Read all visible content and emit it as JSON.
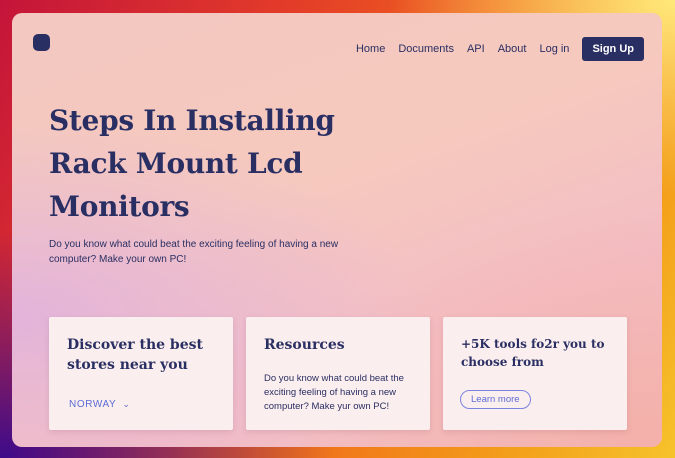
{
  "nav": {
    "items": [
      "Home",
      "Documents",
      "API",
      "About",
      "Log in"
    ],
    "signup_label": "Sign Up"
  },
  "hero": {
    "title": "Steps In Installing Rack Mount Lcd Monitors",
    "subtitle": "Do you know what could beat the exciting feeling of having a new computer? Make your own PC!"
  },
  "cards": [
    {
      "title": "Discover the best stores near you",
      "dropdown_value": "NORWAY"
    },
    {
      "title": "Resources",
      "text": "Do you know what could beat the exciting feeling of having a new computer? Make yur own PC!"
    },
    {
      "title": "+5K tools fo2r you to choose from",
      "button_label": "Learn more"
    }
  ],
  "colors": {
    "navy": "#2a2f63",
    "accent": "#5c6cd6"
  }
}
